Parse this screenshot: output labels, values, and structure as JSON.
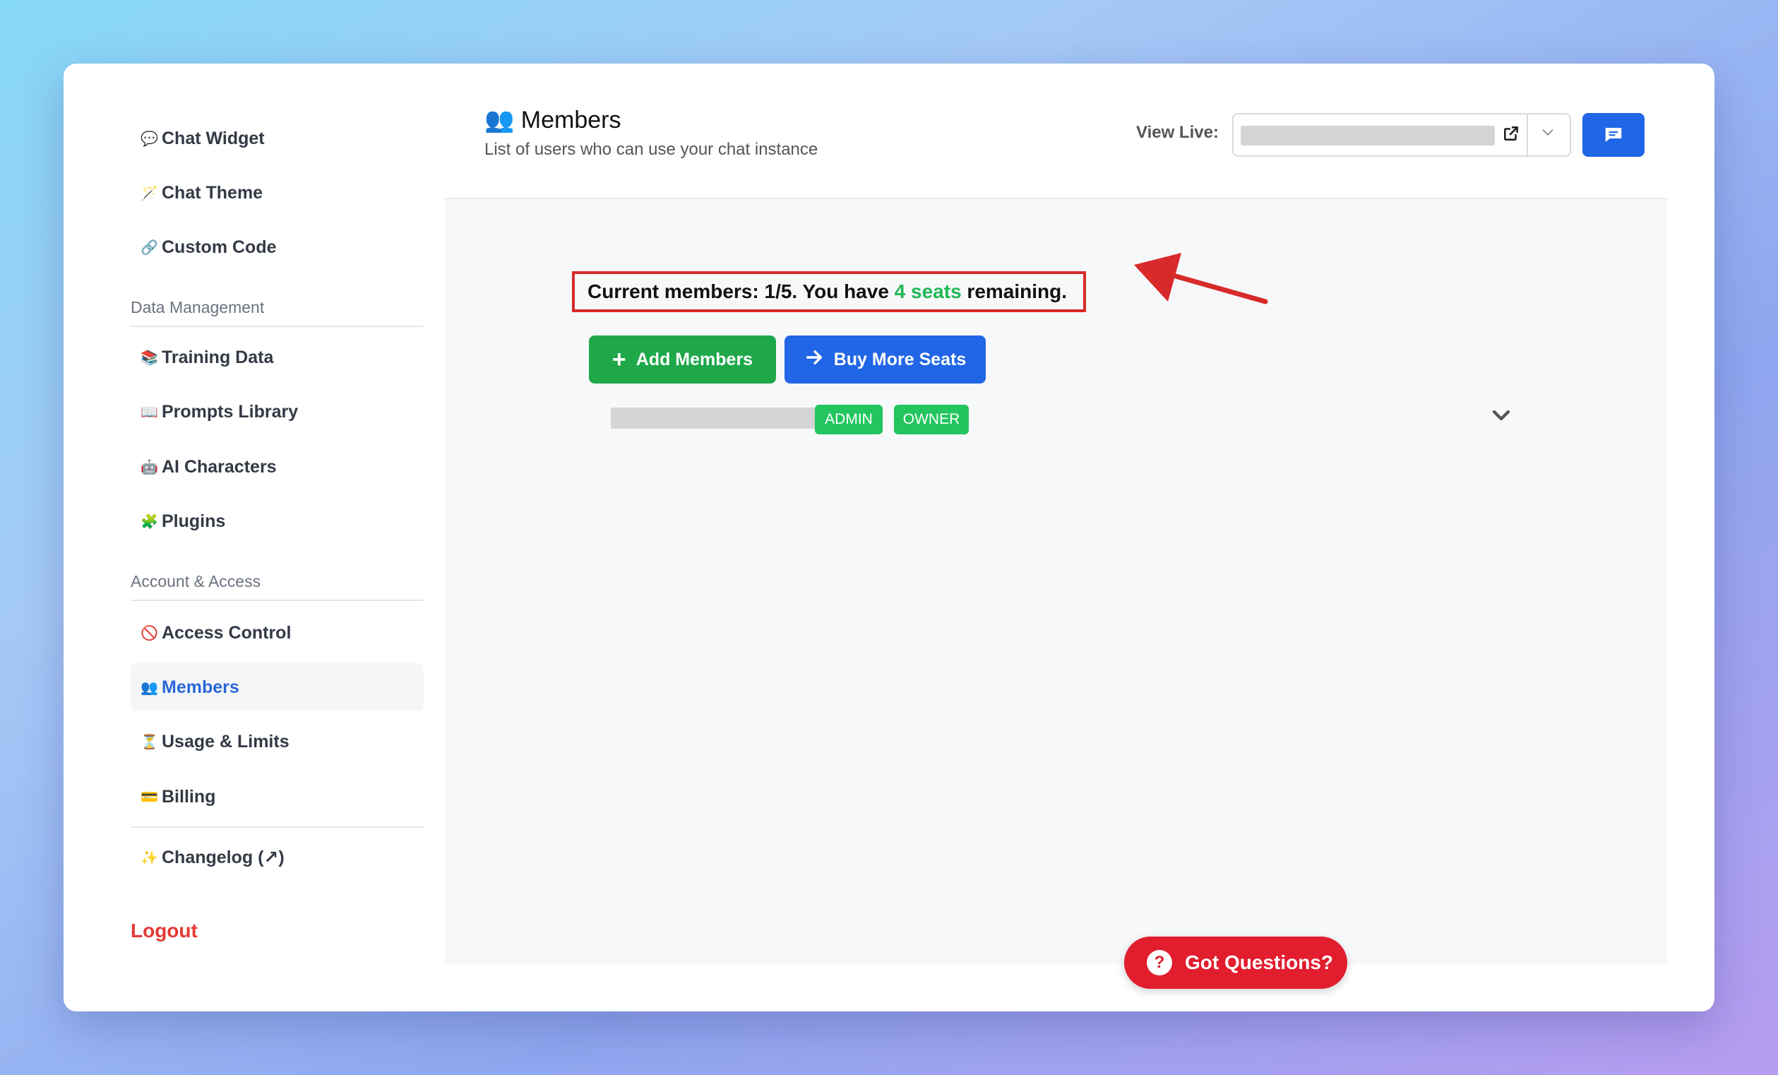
{
  "sidebar": {
    "items_top": [
      {
        "icon": "💬",
        "label": "Chat Widget"
      },
      {
        "icon": "🪄",
        "label": "Chat Theme"
      },
      {
        "icon": "🔗",
        "label": "Custom Code"
      }
    ],
    "data_section": "Data Management",
    "data_items": [
      {
        "icon": "📚",
        "label": "Training Data"
      },
      {
        "icon": "📖",
        "label": "Prompts Library"
      },
      {
        "icon": "🤖",
        "label": "AI Characters"
      },
      {
        "icon": "🧩",
        "label": "Plugins"
      }
    ],
    "account_section": "Account & Access",
    "account_items": [
      {
        "icon": "🚫",
        "label": "Access Control"
      },
      {
        "icon": "👥",
        "label": "Members",
        "active": true
      },
      {
        "icon": "⏳",
        "label": "Usage & Limits"
      },
      {
        "icon": "💳",
        "label": "Billing"
      }
    ],
    "changelog": {
      "icon": "✨",
      "label": "Changelog (↗)"
    },
    "logout": "Logout"
  },
  "header": {
    "title_icon": "👥",
    "title": "Members",
    "subtitle": "List of users who can use your chat instance",
    "view_live_label": "View Live:"
  },
  "members": {
    "summary_prefix": "Current members: 1/5. You have ",
    "seats_highlight": "4 seats",
    "summary_suffix": " remaining.",
    "add_button": "Add Members",
    "buy_button": "Buy More Seats",
    "rows": [
      {
        "badges": [
          "ADMIN",
          "OWNER"
        ]
      }
    ]
  },
  "help": {
    "label": "Got Questions?",
    "icon": "?"
  },
  "colors": {
    "primary_blue": "#2166e6",
    "green": "#1fa84a",
    "badge_green": "#22c55e",
    "danger_red": "#e11d2e",
    "highlight_box": "#d82a2a"
  }
}
